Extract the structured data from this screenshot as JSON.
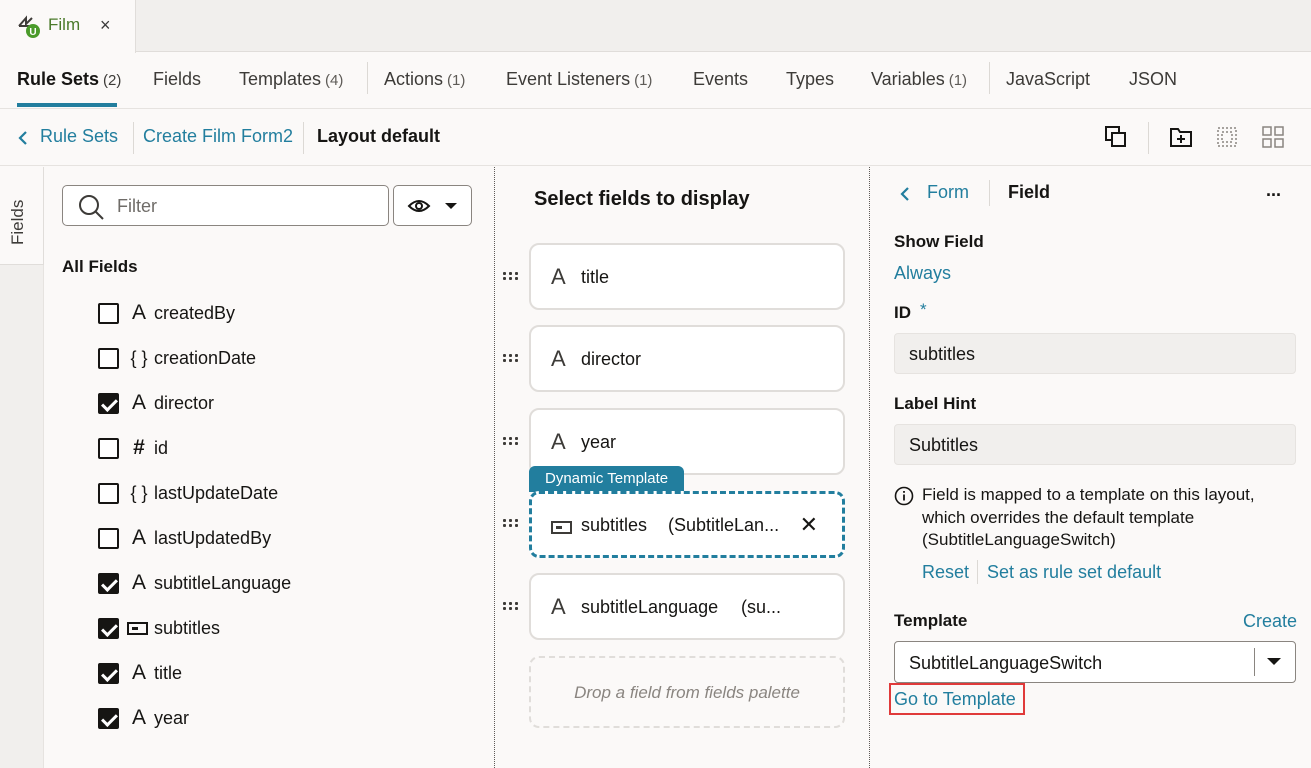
{
  "doc_tab": {
    "title": "Film",
    "close": "×",
    "logo_icon": "visual-builder-u-icon"
  },
  "nav": {
    "tabs": [
      {
        "label": "Rule Sets",
        "count": "(2)",
        "active": true
      },
      {
        "label": "Fields",
        "count": ""
      },
      {
        "label": "Templates",
        "count": "(4)"
      },
      {
        "label": "Actions",
        "count": "(1)"
      },
      {
        "label": "Event Listeners",
        "count": "(1)"
      },
      {
        "label": "Events",
        "count": ""
      },
      {
        "label": "Types",
        "count": ""
      },
      {
        "label": "Variables",
        "count": "(1)"
      },
      {
        "label": "JavaScript",
        "count": ""
      },
      {
        "label": "JSON",
        "count": ""
      }
    ]
  },
  "breadcrumb": {
    "back": "Rule Sets",
    "parent": "Create Film Form2",
    "current": "Layout default",
    "tools": [
      "duplicate-icon",
      "add-folder-icon",
      "grid-select-icon",
      "grid-icon"
    ]
  },
  "palette": {
    "vertical_tab": "Fields",
    "filter_placeholder": "Filter",
    "heading": "All Fields",
    "fields": [
      {
        "name": "createdBy",
        "type": "A",
        "checked": false
      },
      {
        "name": "creationDate",
        "type": "{ }",
        "checked": false
      },
      {
        "name": "director",
        "type": "A",
        "checked": true
      },
      {
        "name": "id",
        "type": "#",
        "checked": false
      },
      {
        "name": "lastUpdateDate",
        "type": "{ }",
        "checked": false
      },
      {
        "name": "lastUpdatedBy",
        "type": "A",
        "checked": false
      },
      {
        "name": "subtitleLanguage",
        "type": "A",
        "checked": true
      },
      {
        "name": "subtitles",
        "type": "template",
        "checked": true
      },
      {
        "name": "title",
        "type": "A",
        "checked": true
      },
      {
        "name": "year",
        "type": "A",
        "checked": true
      }
    ]
  },
  "layout": {
    "title": "Select fields to display",
    "cards": [
      {
        "label": "title",
        "sub": ""
      },
      {
        "label": "director",
        "sub": ""
      },
      {
        "label": "year",
        "sub": ""
      },
      {
        "label": "subtitles",
        "sub": "(SubtitleLan...",
        "badge": "Dynamic Template",
        "selected": true
      },
      {
        "label": "subtitleLanguage",
        "sub": "(su..."
      }
    ],
    "drop_hint": "Drop a field from fields palette"
  },
  "properties": {
    "back": "Form",
    "title": "Field",
    "more": "...",
    "show_field_label": "Show Field",
    "show_field_value": "Always",
    "id_label": "ID",
    "id_required": "*",
    "id_value": "subtitles",
    "label_hint_label": "Label Hint",
    "label_hint_value": "Subtitles",
    "info_text": "Field is mapped to a template on this layout, which overrides the default template (SubtitleLanguageSwitch)",
    "reset": "Reset",
    "set_default": "Set as rule set default",
    "template_label": "Template",
    "create": "Create",
    "template_value": "SubtitleLanguageSwitch",
    "go_to_template": "Go to Template"
  },
  "colors": {
    "accent": "#227e9e",
    "highlight": "#e03a3a",
    "brand_green": "#4a7a2a"
  }
}
